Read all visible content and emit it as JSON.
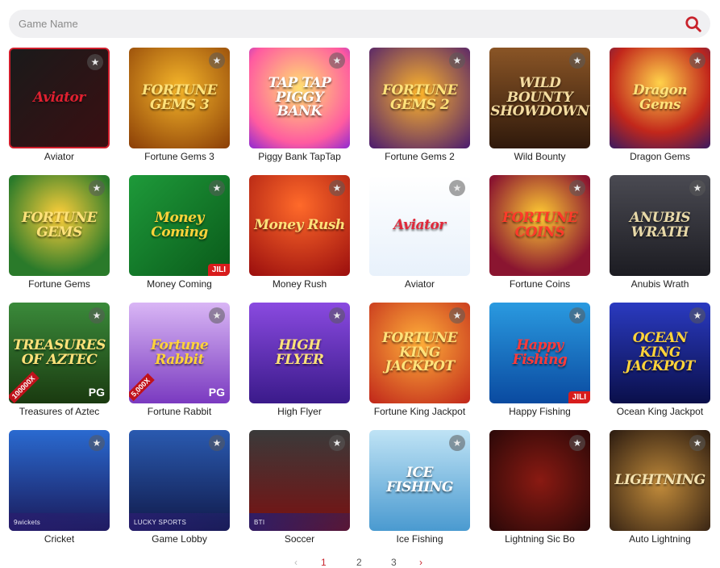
{
  "search": {
    "placeholder": "Game Name",
    "value": ""
  },
  "games": [
    {
      "name": "Aviator",
      "art": "Aviator",
      "bg": "linear-gradient(135deg,#1a1a1a,#3a0f12)",
      "fg": "#e02030",
      "border": "#d01e2c"
    },
    {
      "name": "Fortune Gems 3",
      "art": "FORTUNE GEMS 3",
      "bg": "radial-gradient(circle at 50% 40%,#f5b62a,#8a3d06)",
      "fg": "#ffe27a"
    },
    {
      "name": "Piggy Bank TapTap",
      "art": "TAP TAP PIGGY BANK",
      "bg": "radial-gradient(circle at 50% 40%,#ffe071,#ff5ba0 70%,#8f2ad1)",
      "fg": "#ffffff"
    },
    {
      "name": "Fortune Gems 2",
      "art": "FORTUNE GEMS 2",
      "bg": "radial-gradient(circle at 50% 45%,#ffb62b,#4a1a6e)",
      "fg": "#ffe27a"
    },
    {
      "name": "Wild Bounty",
      "art": "WILD BOUNTY SHOWDOWN",
      "bg": "linear-gradient(180deg,#8a5526,#2f190b)",
      "fg": "#f4dca0"
    },
    {
      "name": "Dragon Gems",
      "art": "Dragon Gems",
      "bg": "radial-gradient(circle at 50% 35%,#ffd24a,#c2271b 60%,#3a1a60)",
      "fg": "#ffe27a"
    },
    {
      "name": "Fortune Gems",
      "art": "FORTUNE GEMS",
      "bg": "radial-gradient(circle at 50% 40%,#ffcf3a,#2a7a2a 75%)",
      "fg": "#ffe27a"
    },
    {
      "name": "Money Coming",
      "art": "Money Coming",
      "bg": "linear-gradient(135deg,#1e9a3a,#0a5a1a)",
      "fg": "#ffd33a",
      "badge": "JILI"
    },
    {
      "name": "Money Rush",
      "art": "Money Rush",
      "bg": "radial-gradient(circle at 50% 30%,#ff6a2a,#9a0d0d)",
      "fg": "#ffe27a"
    },
    {
      "name": "Aviator",
      "art": "Aviator",
      "bg": "linear-gradient(180deg,#ffffff,#e8f1fb)",
      "fg": "#e0283a"
    },
    {
      "name": "Fortune Coins",
      "art": "FORTUNE COINS",
      "bg": "radial-gradient(circle at 50% 40%,#ffcc33,#8a1530 75%)",
      "fg": "#ff3a2a"
    },
    {
      "name": "Anubis Wrath",
      "art": "ANUBIS WRATH",
      "bg": "linear-gradient(180deg,#4a4a52,#1c1c22)",
      "fg": "#e8d9a8"
    },
    {
      "name": "Treasures of Aztec",
      "art": "TREASURES OF AZTEC",
      "bg": "linear-gradient(180deg,#3a8a3a,#1a3a10)",
      "fg": "#ffe27a",
      "ribbon": "100000X",
      "provider": "PG"
    },
    {
      "name": "Fortune Rabbit",
      "art": "Fortune Rabbit",
      "bg": "linear-gradient(180deg,#d9b6f5,#7a3ac0)",
      "fg": "#ffd33a",
      "ribbon": "5,000X",
      "provider": "PG"
    },
    {
      "name": "High Flyer",
      "art": "HIGH FLYER",
      "bg": "linear-gradient(180deg,#8a4ae0,#3a1a8a)",
      "fg": "#ffe27a"
    },
    {
      "name": "Fortune King Jackpot",
      "art": "FORTUNE KING JACKPOT",
      "bg": "radial-gradient(circle at 50% 40%,#ffb03a,#c0261a)",
      "fg": "#ffe27a"
    },
    {
      "name": "Happy Fishing",
      "art": "Happy Fishing",
      "bg": "linear-gradient(180deg,#2a9ae0,#0a4aa0)",
      "fg": "#ff3a3a",
      "badge": "JILI"
    },
    {
      "name": "Ocean King Jackpot",
      "art": "OCEAN KING JACKPOT",
      "bg": "linear-gradient(180deg,#2a3ac0,#0a0f4a)",
      "fg": "#ffd33a"
    },
    {
      "name": "Cricket",
      "art": "",
      "bg": "linear-gradient(180deg,#2a6ad0,#1a1a5a)",
      "fg": "#ffffff",
      "strip": "9wickets"
    },
    {
      "name": "Game Lobby",
      "art": "",
      "bg": "linear-gradient(180deg,#2a5ab0,#101a4a)",
      "fg": "#ffffff",
      "strip": "LUCKY SPORTS"
    },
    {
      "name": "Soccer",
      "art": "",
      "bg": "linear-gradient(180deg,#3a3a3a,#7a1010)",
      "fg": "#ffffff",
      "strip": "BTI"
    },
    {
      "name": "Ice Fishing",
      "art": "ICE FISHING",
      "bg": "linear-gradient(180deg,#bfe3f5,#4a9ad0)",
      "fg": "#ffffff"
    },
    {
      "name": "Lightning Sic Bo",
      "art": "",
      "bg": "radial-gradient(circle at 50% 50%,#8a1a12,#2a0808)",
      "fg": "#ffffff"
    },
    {
      "name": "Auto Lightning",
      "art": "LIGHTNING",
      "bg": "radial-gradient(circle at 50% 55%,#c08a3a,#2a1a10)",
      "fg": "#f5e3b0"
    }
  ],
  "pagination": {
    "prev": "‹",
    "pages": [
      "1",
      "2",
      "3"
    ],
    "current": "1",
    "next": "›"
  },
  "colors": {
    "accent": "#c8232c",
    "search_bg": "#f0f0f2"
  }
}
